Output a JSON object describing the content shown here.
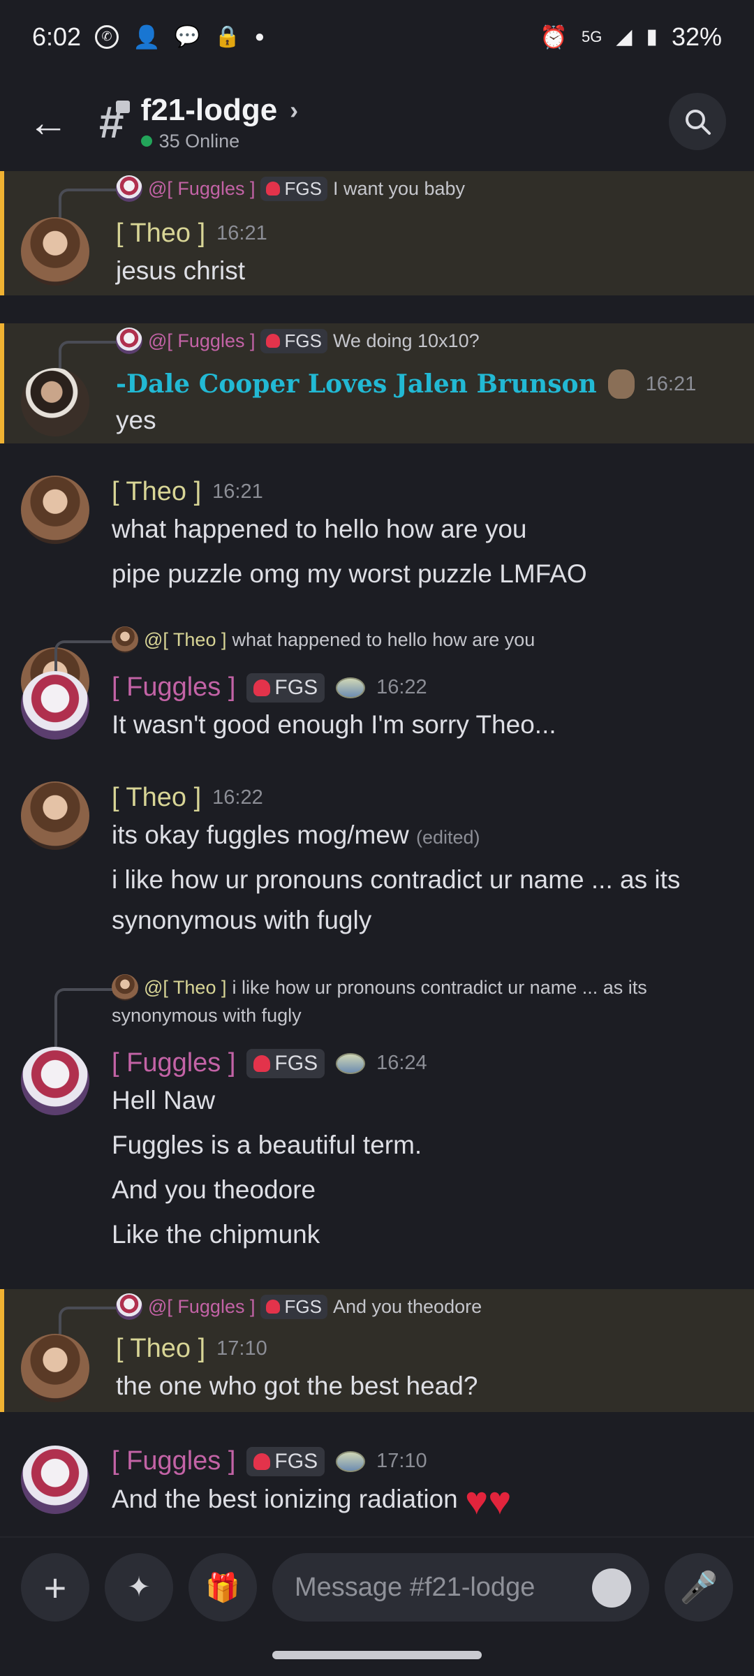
{
  "status": {
    "time": "6:02",
    "network": "5G",
    "battery": "32%"
  },
  "header": {
    "channel_name": "f21-lodge",
    "online": "35 Online"
  },
  "compose": {
    "placeholder": "Message #f21-lodge"
  },
  "messages": [
    {
      "reply": {
        "name": "@[ Fuggles ]",
        "tag": "FGS",
        "text": "I want you baby"
      },
      "user": "[ Theo ]",
      "time": "16:21",
      "lines": [
        "jesus christ"
      ]
    },
    {
      "reply": {
        "name": "@[ Fuggles ]",
        "tag": "FGS",
        "text": "We doing 10x10?"
      },
      "user": "-Dale Cooper Loves Jalen Brunson",
      "time": "16:21",
      "lines": [
        "yes"
      ]
    },
    {
      "user": "[ Theo ]",
      "time": "16:21",
      "lines": [
        "what happened to hello how are you",
        "pipe puzzle omg my worst puzzle LMFAO"
      ]
    },
    {
      "reply": {
        "name": "@[ Theo ]",
        "text": "what happened to hello how are you"
      },
      "user": "[ Fuggles ]",
      "tag": "FGS",
      "time": "16:22",
      "lines": [
        "It wasn't good enough I'm sorry Theo..."
      ]
    },
    {
      "user": "[ Theo ]",
      "time": "16:22",
      "lines": [
        "its okay fuggles mog/mew",
        "i like how ur pronouns contradict ur name ... as its",
        "synonymous with fugly"
      ],
      "edited": "(edited)"
    },
    {
      "reply": {
        "name": "@[ Theo ]",
        "text": "i like how ur pronouns contradict ur name ... as its",
        "text2": "synonymous with fugly"
      },
      "user": "[ Fuggles ]",
      "tag": "FGS",
      "time": "16:24",
      "lines": [
        "Hell Naw",
        "Fuggles is a beautiful term.",
        "And you theodore",
        "Like the chipmunk"
      ]
    },
    {
      "reply": {
        "name": "@[ Fuggles ]",
        "tag": "FGS",
        "text": "And you theodore"
      },
      "user": "[ Theo ]",
      "time": "17:10",
      "lines": [
        "the one who got the best head?"
      ]
    },
    {
      "user": "[ Fuggles ]",
      "tag": "FGS",
      "time": "17:10",
      "lines": [
        "And the best ionizing radiation"
      ]
    }
  ]
}
